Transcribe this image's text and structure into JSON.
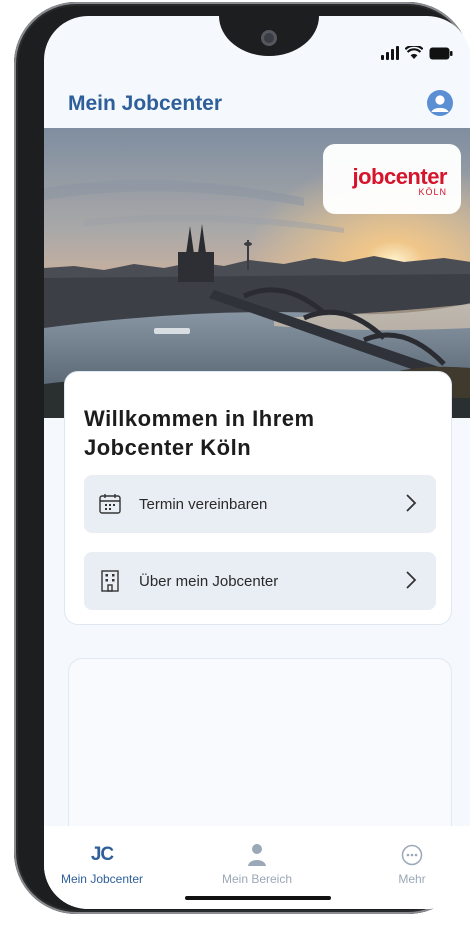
{
  "app": {
    "title": "Mein Jobcenter"
  },
  "hero": {
    "logo_main": "jobcenter",
    "logo_sub": "KÖLN"
  },
  "welcome": {
    "title": "Willkommen in Ihrem Jobcenter Köln",
    "actions": [
      {
        "label": "Termin vereinbaren",
        "icon": "calendar-icon"
      },
      {
        "label": "Über mein Jobcenter",
        "icon": "building-icon"
      }
    ]
  },
  "nav": {
    "items": [
      {
        "label": "Mein Jobcenter",
        "icon": "jc-logo-icon",
        "active": true
      },
      {
        "label": "Mein Bereich",
        "icon": "person-icon",
        "active": false
      },
      {
        "label": "Mehr",
        "icon": "more-icon",
        "active": false
      }
    ],
    "logo_text": "JC"
  },
  "colors": {
    "brand_blue": "#2e5f9a",
    "logo_red": "#d6152b",
    "inactive": "#9aa8b8"
  }
}
